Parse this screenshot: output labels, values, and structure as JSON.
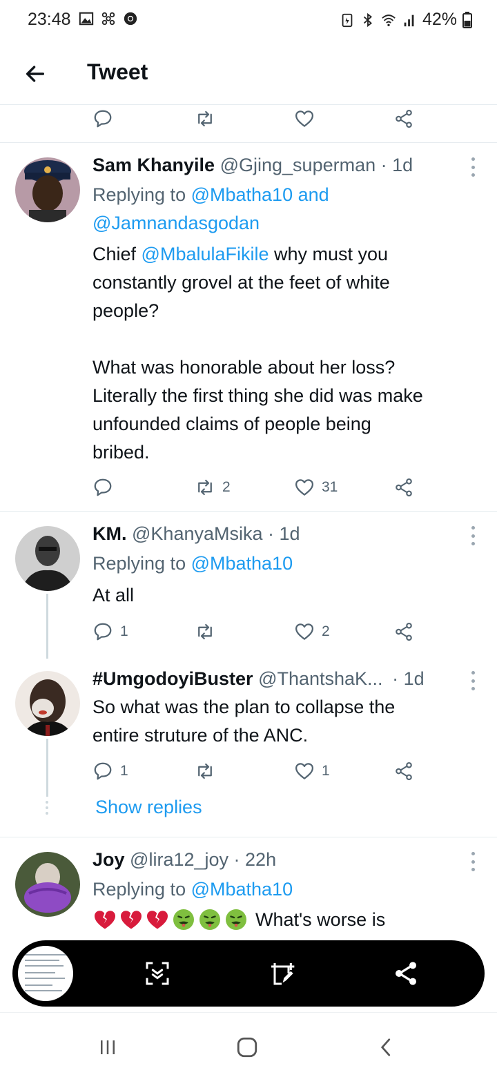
{
  "status_bar": {
    "time": "23:48",
    "battery": "42%",
    "icons_left": [
      "gallery-icon",
      "pinwheel-icon",
      "chrome-icon"
    ],
    "icons_right": [
      "battery-saver-icon",
      "bluetooth-icon",
      "wifi-icon",
      "signal-icon",
      "battery-icon"
    ]
  },
  "app_bar": {
    "title": "Tweet"
  },
  "tweets": [
    {
      "name": "Sam Khanyile",
      "handle": "@Gjing_superman",
      "time": "· 1d",
      "replying_prefix": "Replying to ",
      "replying_mention1": "@Mbatha10",
      "replying_and": " and",
      "replying_mention2": "@Jamnandasgodan",
      "body_line1_prefix": "Chief ",
      "body_mention": "@MbalulaFikile",
      "body_line1_suffix": " why must you",
      "body_line2": "constantly grovel at the feet of white",
      "body_line3": "people?",
      "body_para2_line1": "What was honorable about her loss?",
      "body_para2_line2": "Literally the first thing she did was make",
      "body_para2_line3": "unfounded claims of people being",
      "body_para2_line4": "bribed.",
      "replies": "",
      "retweets": "2",
      "likes": "31"
    },
    {
      "name": "KM.",
      "handle": "@KhanyaMsika",
      "time": "· 1d",
      "replying_prefix": "Replying to ",
      "replying_mention1": "@Mbatha10",
      "body": "At all",
      "replies": "1",
      "retweets": "",
      "likes": "2"
    },
    {
      "name": "#UmgodoyiBuster",
      "handle": "@ThantshaK...",
      "time": "· 1d",
      "body_line1": "So what was the plan to collapse the",
      "body_line2": "entire struture of the ANC.",
      "replies": "1",
      "retweets": "",
      "likes": "1"
    },
    {
      "name": "Joy",
      "handle": "@lira12_joy",
      "time": "· 22h",
      "replying_prefix": "Replying to ",
      "replying_mention1": "@Mbatha10",
      "body_text": "What's worse is",
      "emojis": [
        "broken-heart",
        "broken-heart",
        "broken-heart",
        "nauseated-face",
        "nauseated-face",
        "nauseated-face"
      ]
    }
  ],
  "thread": {
    "show_replies": "Show replies"
  },
  "overlay_toolbar": {
    "buttons": [
      "scroll-capture-icon",
      "edit-screenshot-icon",
      "share-icon"
    ]
  },
  "nav_bar": {
    "buttons": [
      "recents-icon",
      "home-icon",
      "back-icon"
    ]
  },
  "colors": {
    "accent": "#1d9bf0",
    "text_secondary": "#536471",
    "divider": "#e6ecf0"
  }
}
